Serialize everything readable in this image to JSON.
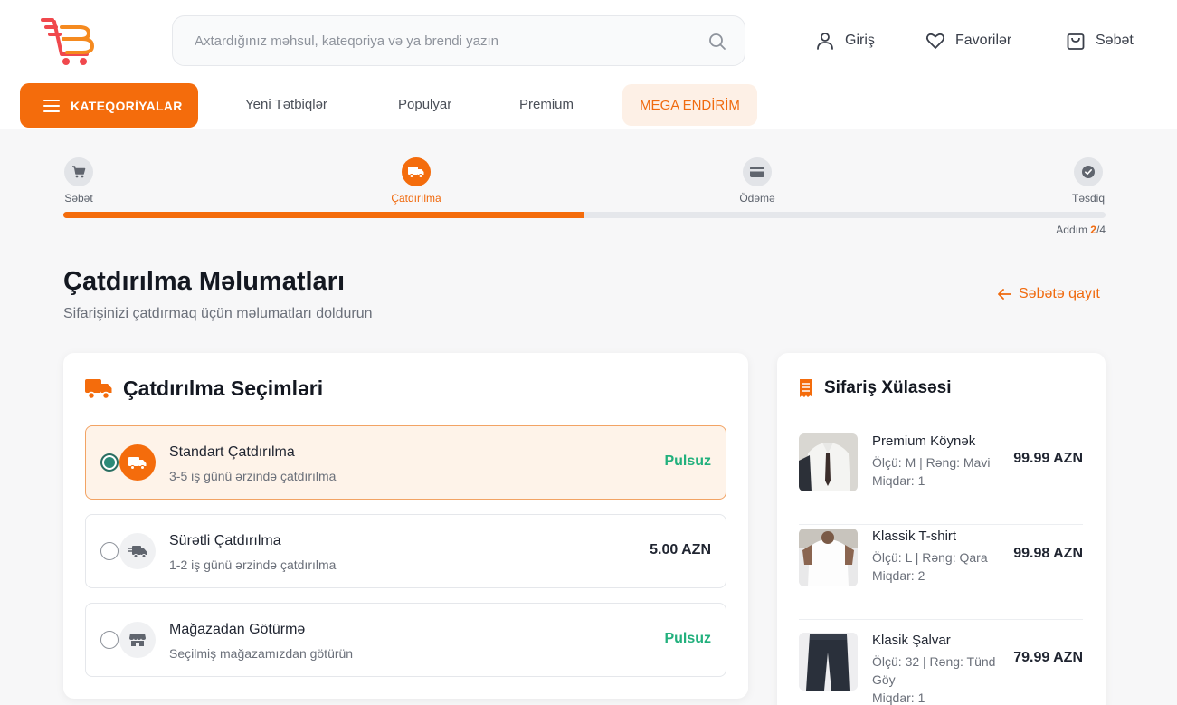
{
  "header": {
    "search_placeholder": "Axtardığınız məhsul, kateqoriya və ya brendi yazın",
    "login": "Giriş",
    "favorites": "Favorilər",
    "cart": "Səbət"
  },
  "nav": {
    "categories": "KATEQORİYALAR",
    "links": [
      "Yeni Tətbiqlər",
      "Populyar",
      "Premium"
    ],
    "mega": "MEGA ENDİRİM"
  },
  "stepper": {
    "steps": [
      {
        "label": "Səbət",
        "icon": "cart-icon"
      },
      {
        "label": "Çatdırılma",
        "icon": "truck-icon"
      },
      {
        "label": "Ödəmə",
        "icon": "card-icon"
      },
      {
        "label": "Təsdiq",
        "icon": "check-icon"
      }
    ],
    "progress_fraction": 0.5,
    "step_label": "Addım",
    "current": "2",
    "total": "/4"
  },
  "page": {
    "title": "Çatdırılma Məlumatları",
    "subtitle": "Sifarişinizi çatdırmaq üçün məlumatları doldurun",
    "back_label": "Səbətə qayıt"
  },
  "delivery": {
    "title": "Çatdırılma Seçimləri",
    "options": [
      {
        "name": "Standart Çatdırılma",
        "desc": "3-5 iş günü ərzində çatdırılma",
        "price": "Pulsuz",
        "selected": true
      },
      {
        "name": "Sürətli Çatdırılma",
        "desc": "1-2 iş günü ərzində çatdırılma",
        "price": "5.00 AZN",
        "selected": false
      },
      {
        "name": "Mağazadan Götürmə",
        "desc": "Seçilmiş mağazamızdan götürün",
        "price": "Pulsuz",
        "selected": false
      }
    ]
  },
  "summary": {
    "title": "Sifariş Xülasəsi",
    "items": [
      {
        "name": "Premium Köynək",
        "meta1": "Ölçü: M | Rəng: Mavi",
        "meta2": "Miqdar: 1",
        "price": "99.99 AZN"
      },
      {
        "name": "Klassik T-shirt",
        "meta1": "Ölçü: L | Rəng: Qara",
        "meta2": "Miqdar: 2",
        "price": "99.98 AZN"
      },
      {
        "name": "Klasik Şalvar",
        "meta1": "Ölçü: 32 | Rəng: Tünd Göy",
        "meta2": "Miqdar: 1",
        "price": "79.99 AZN"
      }
    ]
  },
  "colors": {
    "accent": "#f46c0c",
    "free": "#22b07d"
  }
}
